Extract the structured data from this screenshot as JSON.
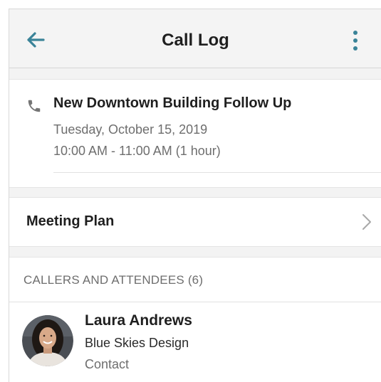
{
  "header": {
    "title": "Call Log",
    "back_icon": "arrow-left-icon",
    "more_icon": "more-vertical-icon",
    "accent_color": "#3a8398"
  },
  "event": {
    "icon": "phone-icon",
    "title": "New Downtown Building Follow Up",
    "date": "Tuesday, October 15, 2019",
    "time": "10:00 AM - 11:00 AM (1 hour)"
  },
  "meeting_plan": {
    "label": "Meeting Plan",
    "icon": "chevron-right-icon"
  },
  "callers": {
    "section_label": "CALLERS AND ATTENDEES (6)",
    "people": [
      {
        "name": "Laura Andrews",
        "company": "Blue Skies Design",
        "type": "Contact"
      }
    ]
  }
}
